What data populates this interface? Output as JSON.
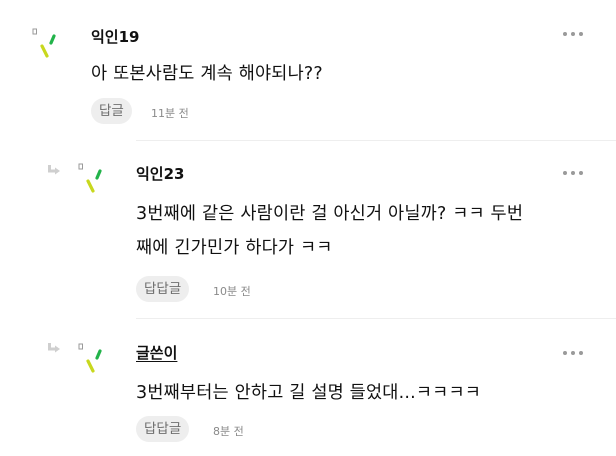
{
  "colors": {
    "accent_yellow": "#c8d81e",
    "accent_green": "#22b34a",
    "text": "#111111",
    "meta": "#8a8a8a",
    "button_bg": "#eeeeee"
  },
  "comments": [
    {
      "author": "익인19",
      "body_lines": [
        "아 또본사람도 계속 해야되나??"
      ],
      "reply_label": "답글",
      "time": "11분 전",
      "is_reply": false
    },
    {
      "author": "익인23",
      "body_lines": [
        "3번째에 같은 사람이란 걸 아신거 아닐까? ㅋㅋ 두번",
        "째에 긴가민가 하다가 ㅋㅋ"
      ],
      "reply_label": "답답글",
      "time": "10분 전",
      "is_reply": true
    },
    {
      "author": "글쓴이",
      "body_lines": [
        "3번째부터는 안하고 길 설명 들었대...ㅋㅋㅋㅋ"
      ],
      "reply_label": "답답글",
      "time": "8분 전",
      "is_reply": true
    }
  ]
}
